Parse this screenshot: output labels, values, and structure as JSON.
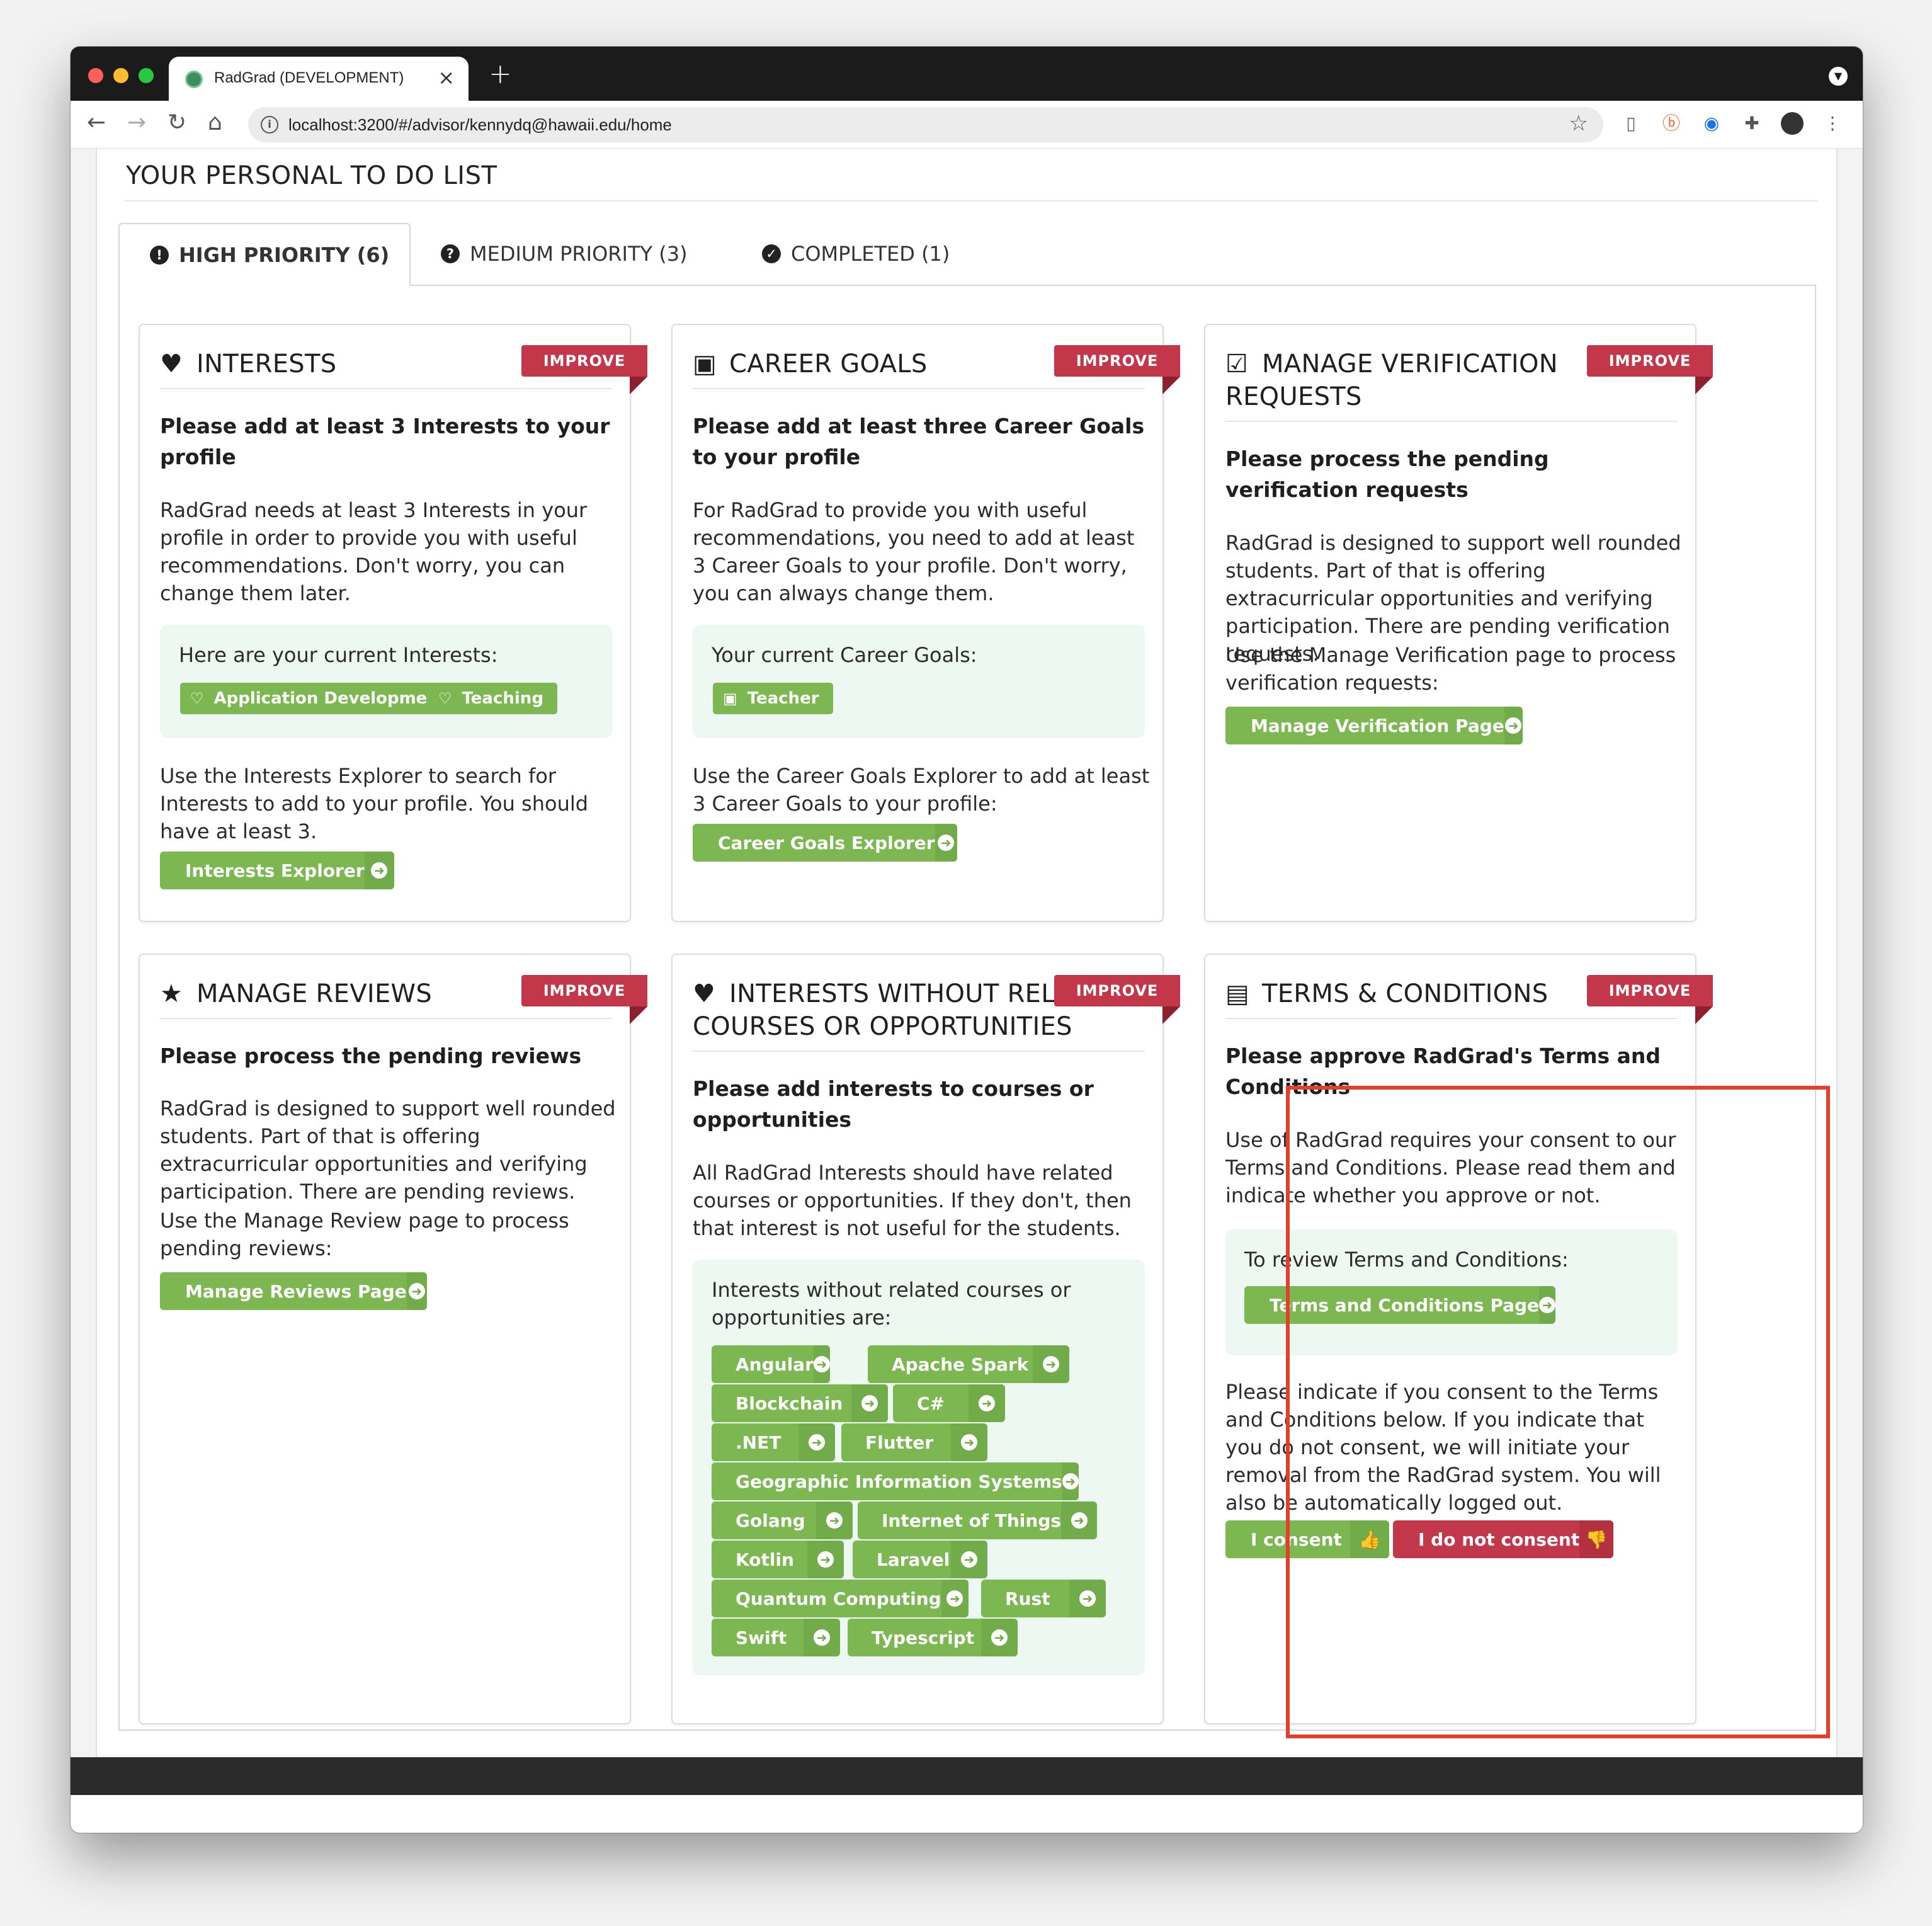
{
  "browser": {
    "tab_title": "RadGrad (DEVELOPMENT)",
    "url": "localhost:3200/#/advisor/kennydq@hawaii.edu/home"
  },
  "page": {
    "heading": "YOUR PERSONAL TO DO LIST",
    "tabs": [
      {
        "label": "HIGH PRIORITY (6)",
        "icon": "exclamation-circle-icon",
        "active": true
      },
      {
        "label": "MEDIUM PRIORITY (3)",
        "icon": "question-circle-icon",
        "active": false
      },
      {
        "label": "COMPLETED (1)",
        "icon": "check-circle-icon",
        "active": false
      }
    ]
  },
  "cards": {
    "interests": {
      "title": "INTERESTS",
      "ribbon": "IMPROVE",
      "subtitle": "Please add at least 3 Interests to your profile",
      "body": "RadGrad needs at least 3 Interests in your profile in order to provide you with useful recommendations. Don't worry, you can change them later.",
      "well_title": "Here are your current Interests:",
      "labels": [
        "Application Development",
        "Teaching"
      ],
      "footer_text": "Use the Interests Explorer to search for Interests to add to your profile. You should have at least 3.",
      "button": "Interests Explorer"
    },
    "career_goals": {
      "title": "CAREER GOALS",
      "ribbon": "IMPROVE",
      "subtitle": "Please add at least three Career Goals to your profile",
      "body": "For RadGrad to provide you with useful recommendations, you need to add at least 3 Career Goals to your profile. Don't worry, you can always change them.",
      "well_title": "Your current Career Goals:",
      "labels": [
        "Teacher"
      ],
      "footer_text": "Use the Career Goals Explorer to add at least 3 Career Goals to your profile:",
      "button": "Career Goals Explorer"
    },
    "verification": {
      "title_line1": "MANAGE VERIFICATION",
      "title_line2": "REQUESTS",
      "ribbon": "IMPROVE",
      "subtitle": "Please process the pending verification requests",
      "body": "RadGrad is designed to support well rounded students. Part of that is offering extracurricular opportunities and verifying participation. There are pending verification requests.",
      "footer_text": "Use the Manage Verification page to process verification requests:",
      "button": "Manage Verification Page"
    },
    "reviews": {
      "title": "MANAGE REVIEWS",
      "ribbon": "IMPROVE",
      "subtitle": "Please process the pending reviews",
      "body": "RadGrad is designed to support well rounded students. Part of that is offering extracurricular opportunities and verifying participation. There are pending reviews.",
      "footer_text": "Use the Manage Review page to process pending reviews:",
      "button": "Manage Reviews Page"
    },
    "interests_without": {
      "title_line1": "INTERESTS WITHOUT REL",
      "title_line2": "COURSES OR OPPORTUNITIES",
      "ribbon": "IMPROVE",
      "subtitle": "Please add interests to courses or opportunities",
      "body": "All RadGrad Interests should have related courses or opportunities. If they don't, then that interest is not useful for the students.",
      "well_title": "Interests without related courses or opportunities are:",
      "chips": [
        "Angular",
        "Apache Spark",
        "Blockchain",
        "C#",
        ".NET",
        "Flutter",
        "Geographic Information Systems",
        "Golang",
        "Internet of Things",
        "Kotlin",
        "Laravel",
        "Quantum Computing",
        "Rust",
        "Swift",
        "Typescript"
      ]
    },
    "terms": {
      "title": "TERMS & CONDITIONS",
      "ribbon": "IMPROVE",
      "subtitle": "Please approve RadGrad's Terms and Conditions",
      "body": "Use of RadGrad requires your consent to our Terms and Conditions. Please read them and indicate whether you approve or not.",
      "well_title": "To review Terms and Conditions:",
      "button": "Terms and Conditions Page",
      "footer_text": "Please indicate if you consent to the Terms and Conditions below. If you indicate that you do not consent, we will initiate your removal from the RadGrad system. You will also be automatically logged out.",
      "consent_button": "I consent",
      "no_consent_button": "I do not consent"
    }
  },
  "colors": {
    "green": "#7cb752",
    "red_ribbon": "#c2384a",
    "highlight": "#e2402c"
  }
}
